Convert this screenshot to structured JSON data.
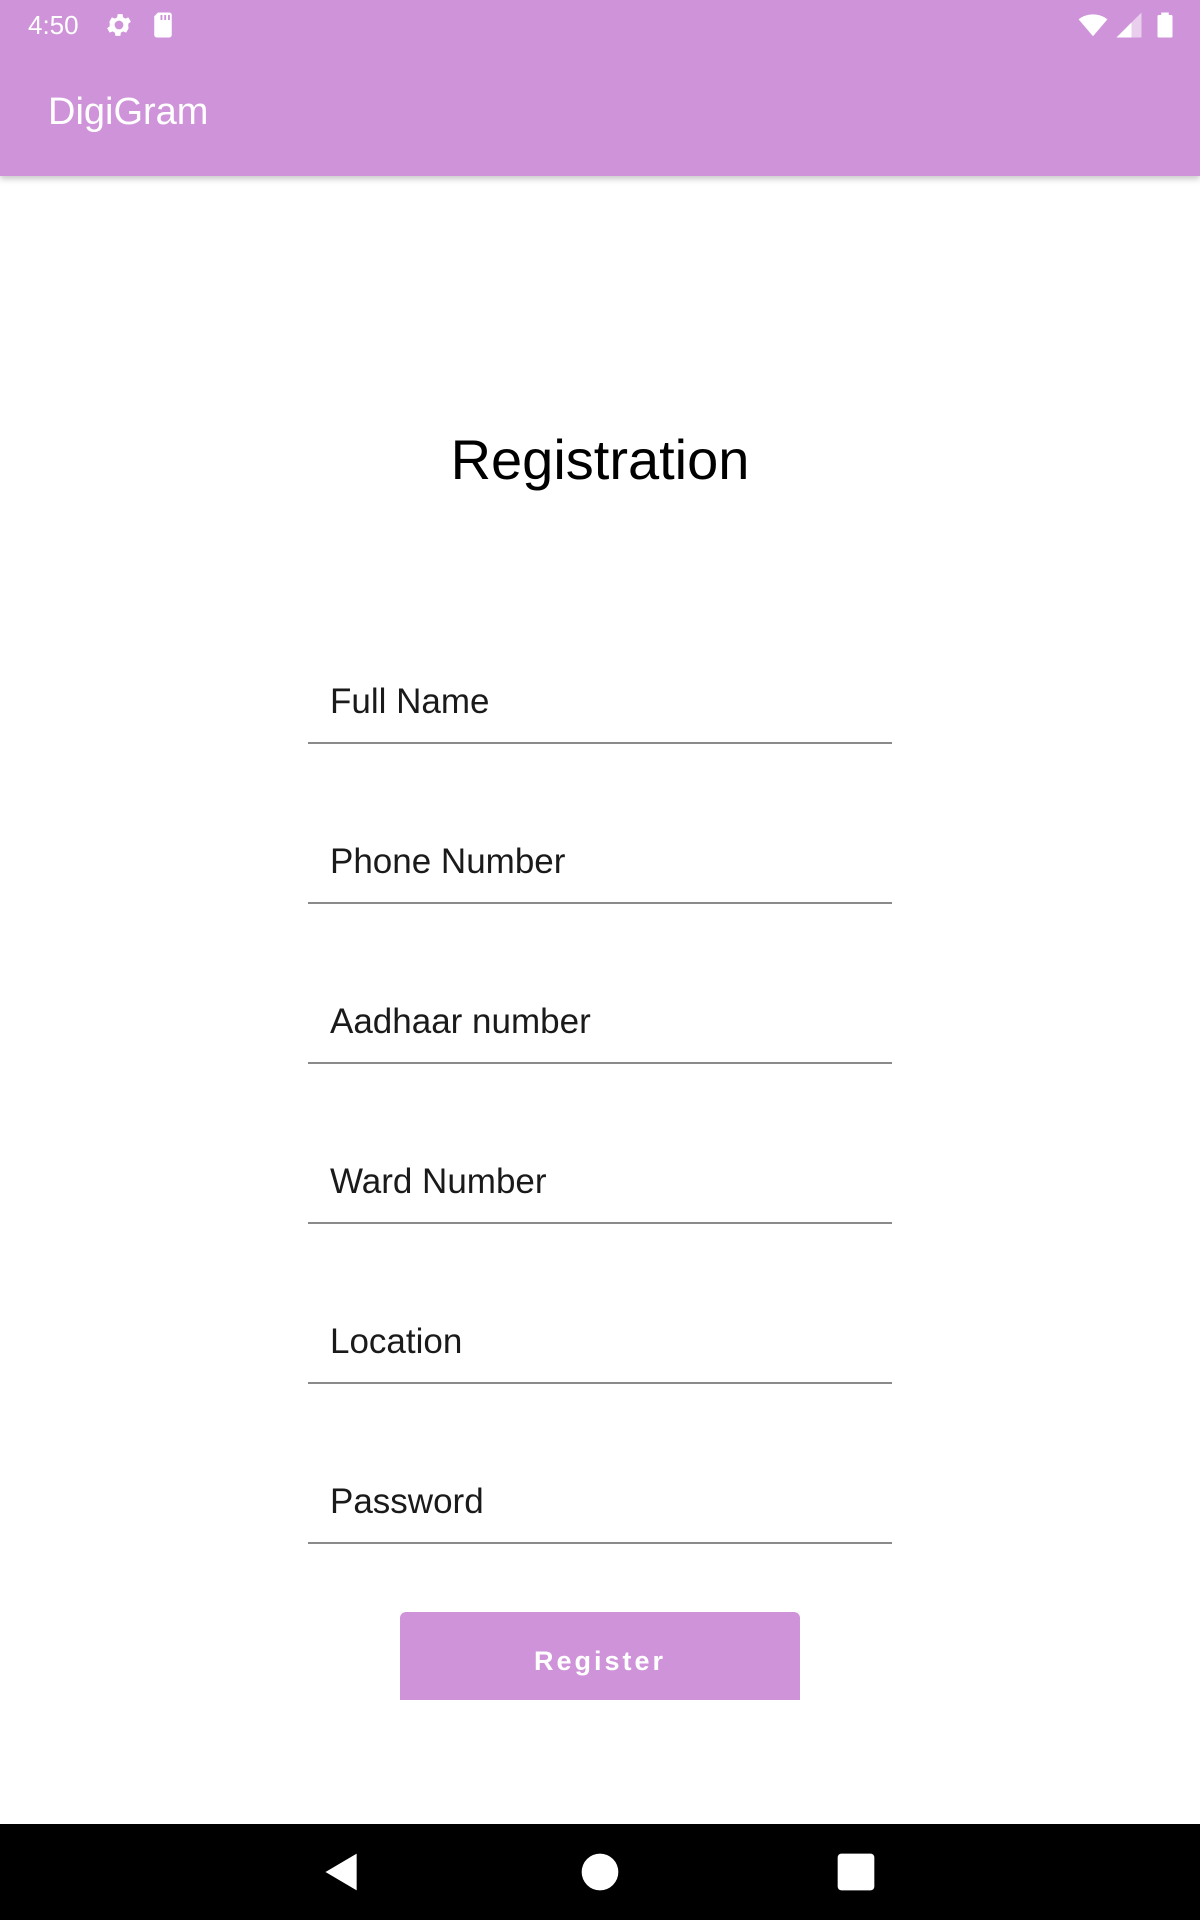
{
  "status_bar": {
    "time": "4:50",
    "icons": [
      "gear-icon",
      "sd-card-icon",
      "wifi-icon",
      "signal-icon",
      "battery-icon"
    ]
  },
  "app_bar": {
    "title": "DigiGram",
    "color": "#ce93d8"
  },
  "page": {
    "title": "Registration"
  },
  "form": {
    "fields": [
      {
        "placeholder": "Full Name",
        "value": ""
      },
      {
        "placeholder": "Phone Number",
        "value": ""
      },
      {
        "placeholder": "Aadhaar number",
        "value": ""
      },
      {
        "placeholder": "Ward Number",
        "value": ""
      },
      {
        "placeholder": "Location",
        "value": ""
      },
      {
        "placeholder": "Password",
        "value": ""
      }
    ],
    "register_label": "Register"
  },
  "nav_bar": {
    "icons": [
      "back-icon",
      "home-icon",
      "recents-icon"
    ]
  }
}
